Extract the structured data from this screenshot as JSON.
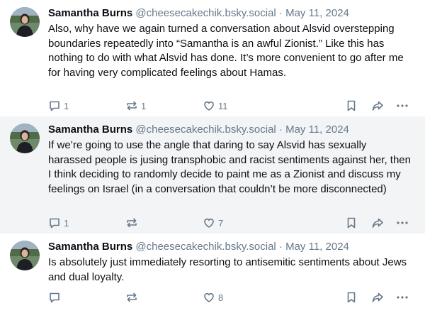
{
  "posts": [
    {
      "name": "Samantha Burns",
      "handle": "@cheesecakechik.bsky.social",
      "separator": "·",
      "date": "May 11, 2024",
      "text": "Also, why have we again turned a conversation about Alsvid overstepping boundaries repeatedly into “Samantha is an awful Zionist.” Like this has nothing to do with what Alsvid has done. It’s more convenient to go after me for having very complicated feelings about Hamas.",
      "replies": "1",
      "reposts": "1",
      "likes": "11"
    },
    {
      "name": "Samantha Burns",
      "handle": "@cheesecakechik.bsky.social",
      "separator": "·",
      "date": "May 11, 2024",
      "text": "If we’re going to use the angle that daring to say Alsvid has sexually harassed people is jusing transphobic and racist sentiments against her, then I think deciding to randomly decide to paint me as a Zionist and discuss my feelings on Israel (in a conversation that couldn’t be more disconnected)",
      "replies": "1",
      "reposts": "",
      "likes": "7"
    },
    {
      "name": "Samantha Burns",
      "handle": "@cheesecakechik.bsky.social",
      "separator": "·",
      "date": "May 11, 2024",
      "text": "Is absolutely just immediately resorting to antisemitic sentiments about Jews and dual loyalty.",
      "replies": "",
      "reposts": "",
      "likes": "8"
    }
  ],
  "icons": {
    "reply": "speech-bubble-icon",
    "repost": "repost-arrows-icon",
    "like": "heart-icon",
    "bookmark": "bookmark-icon",
    "share": "share-arrow-icon",
    "more": "more-dots-icon"
  },
  "colors": {
    "text": "#0b0f14",
    "muted": "#66788a",
    "shaded_background": "#f3f4f6",
    "background": "#ffffff"
  }
}
